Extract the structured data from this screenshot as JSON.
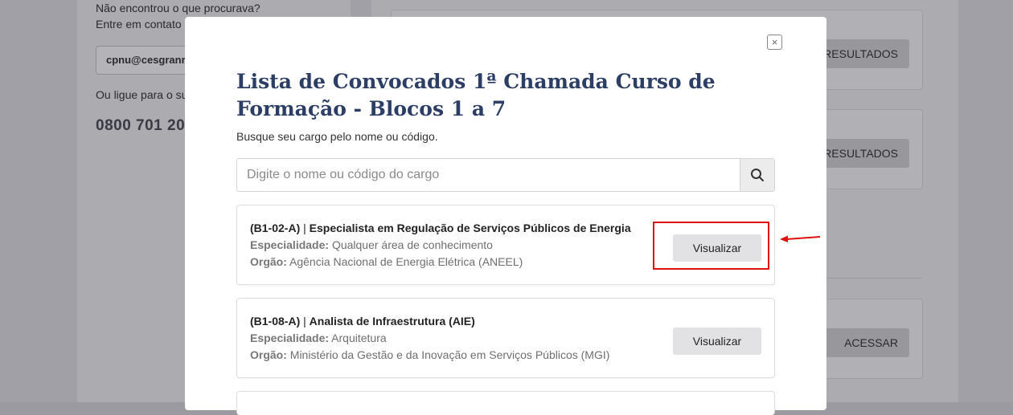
{
  "background": {
    "help_line1": "Não encontrou o que procurava?",
    "help_line2": "Entre em contato",
    "email": "cpnu@cesgranr",
    "phone_prompt": "Ou ligue para o su",
    "phone": "0800 701 20",
    "card1_button": "E RESULTADOS",
    "card2_button": "E RESULTADOS",
    "card3_button": "ACESSAR"
  },
  "modal": {
    "close_symbol": "×",
    "title": "Lista de Convocados 1ª Chamada Curso de Formação - Blocos 1 a 7",
    "subtitle": "Busque seu cargo pelo nome ou código.",
    "search": {
      "placeholder": "Digite o nome ou código do cargo",
      "value": "",
      "icon": "search-icon"
    },
    "results": [
      {
        "code": "(B1-02-A)",
        "separator": "|",
        "title": "Especialista em Regulação de Serviços Públicos de Energia",
        "specialty_label": "Especialidade:",
        "specialty": "Qualquer área de conhecimento",
        "agency_label": "Orgão:",
        "agency": "Agência Nacional de Energia Elétrica (ANEEL)",
        "button": "Visualizar"
      },
      {
        "code": "(B1-08-A)",
        "separator": "|",
        "title": "Analista de Infraestrutura (AIE)",
        "specialty_label": "Especialidade:",
        "specialty": "Arquitetura",
        "agency_label": "Orgão:",
        "agency": "Ministério da Gestão e da Inovação em Serviços Públicos (MGI)",
        "button": "Visualizar"
      }
    ]
  },
  "annotation": {
    "color": "#e01010"
  }
}
